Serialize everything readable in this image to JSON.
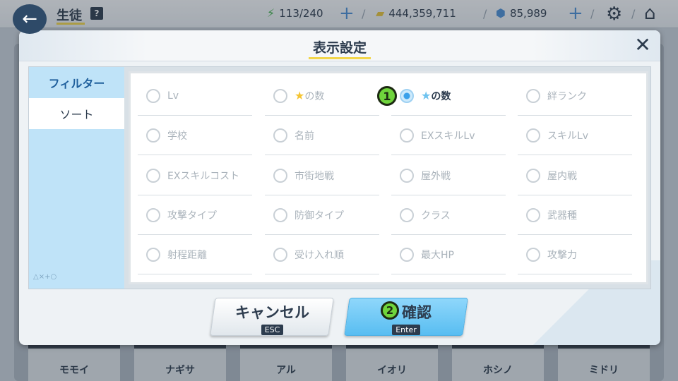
{
  "topbar": {
    "title": "生徒",
    "help": "?",
    "stamina": "113/240",
    "credits": "444,359,711",
    "gems": "85,989"
  },
  "roster": [
    "モモイ",
    "ナギサ",
    "アル",
    "イオリ",
    "ホシノ",
    "ミドリ"
  ],
  "dialog": {
    "title": "表示設定",
    "tabs": [
      {
        "label": "フィルター",
        "active": true
      },
      {
        "label": "ソート",
        "active": false
      }
    ],
    "shapes": "△×+○",
    "options": [
      {
        "label": "Lv",
        "selected": false
      },
      {
        "label": "の数",
        "selected": false,
        "star": "gold"
      },
      {
        "label": "の数",
        "selected": true,
        "star": "blue"
      },
      {
        "label": "絆ランク",
        "selected": false
      },
      {
        "label": "学校",
        "selected": false
      },
      {
        "label": "名前",
        "selected": false
      },
      {
        "label": "EXスキルLv",
        "selected": false
      },
      {
        "label": "スキルLv",
        "selected": false
      },
      {
        "label": "EXスキルコスト",
        "selected": false
      },
      {
        "label": "市街地戦",
        "selected": false
      },
      {
        "label": "屋外戦",
        "selected": false
      },
      {
        "label": "屋内戦",
        "selected": false
      },
      {
        "label": "攻撃タイプ",
        "selected": false
      },
      {
        "label": "防御タイプ",
        "selected": false
      },
      {
        "label": "クラス",
        "selected": false
      },
      {
        "label": "武器種",
        "selected": false
      },
      {
        "label": "射程距離",
        "selected": false
      },
      {
        "label": "受け入れ順",
        "selected": false
      },
      {
        "label": "最大HP",
        "selected": false
      },
      {
        "label": "攻撃力",
        "selected": false
      }
    ],
    "marker1": "1",
    "marker2": "2",
    "cancel": {
      "label": "キャンセル",
      "key": "ESC"
    },
    "confirm": {
      "label": "確認",
      "key": "Enter"
    }
  },
  "colors": {
    "accent": "#58bdf1",
    "highlight": "#6fd43c",
    "underline": "#f2d64b"
  }
}
